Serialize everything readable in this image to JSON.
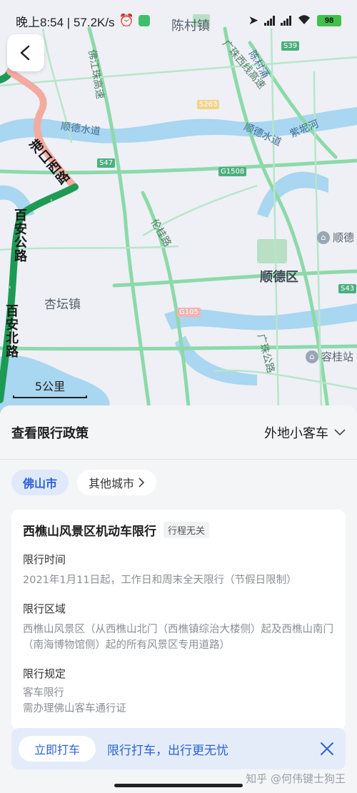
{
  "status_bar": {
    "time_speed": "晚上8:54 | 57.2K/s",
    "battery": "98"
  },
  "map": {
    "labels": {
      "chencun_town": "陈村镇",
      "shunde_district": "顺德区",
      "xingtan_town": "杏坛镇",
      "shunde_poi": "顺德",
      "ronggui_poi": "容桂站",
      "foshan_zhugao": "佛江珠高速",
      "guangzhu_west": "广珠西线高速",
      "chencun_sea": "陈村涌",
      "shunde_waterway_1": "顺德水道",
      "shunde_waterway_2": "顺德水道",
      "ziniha": "紫坭河",
      "lungui_road": "伦桂路",
      "guangzhu_road": "广珠公路"
    },
    "route_labels": {
      "gangkou_west": "港口西路",
      "bai_an_road": "百安公路",
      "bai_an_north": "百安北路"
    },
    "shields": {
      "s39": "S39",
      "s47": "S47",
      "g1508": "G1508",
      "s263": "S263",
      "g105": "G105",
      "s43": "S43"
    },
    "scale": "5公里"
  },
  "sheet": {
    "title": "查看限行政策",
    "vehicle_type": "外地小客车",
    "city_tabs": {
      "active": "佛山市",
      "other": "其他城市"
    },
    "card": {
      "title": "西樵山风景区机动车限行",
      "tag": "行程无关",
      "time_label": "限行时间",
      "time_text": "2021年1月11日起，工作日和周末全天限行（节假日限制）",
      "area_label": "限行区域",
      "area_text": "西樵山风景区（从西樵山北门（西樵镇综治大楼侧）起及西樵山南门（南海博物馆侧）起的所有风景区专用道路）",
      "rule_label": "限行规定",
      "rule_text_1": "客车限行",
      "rule_text_2": "需办理佛山客车通行证"
    }
  },
  "banner": {
    "button": "立即打车",
    "text": "限行打车，出行更无忧"
  },
  "watermark": "知乎 @何伟键士狗王",
  "colors": {
    "accent": "#2c62d6",
    "route_green": "#1e9a55",
    "map_water": "#a9d6f0",
    "map_road": "#8dd9a9"
  }
}
